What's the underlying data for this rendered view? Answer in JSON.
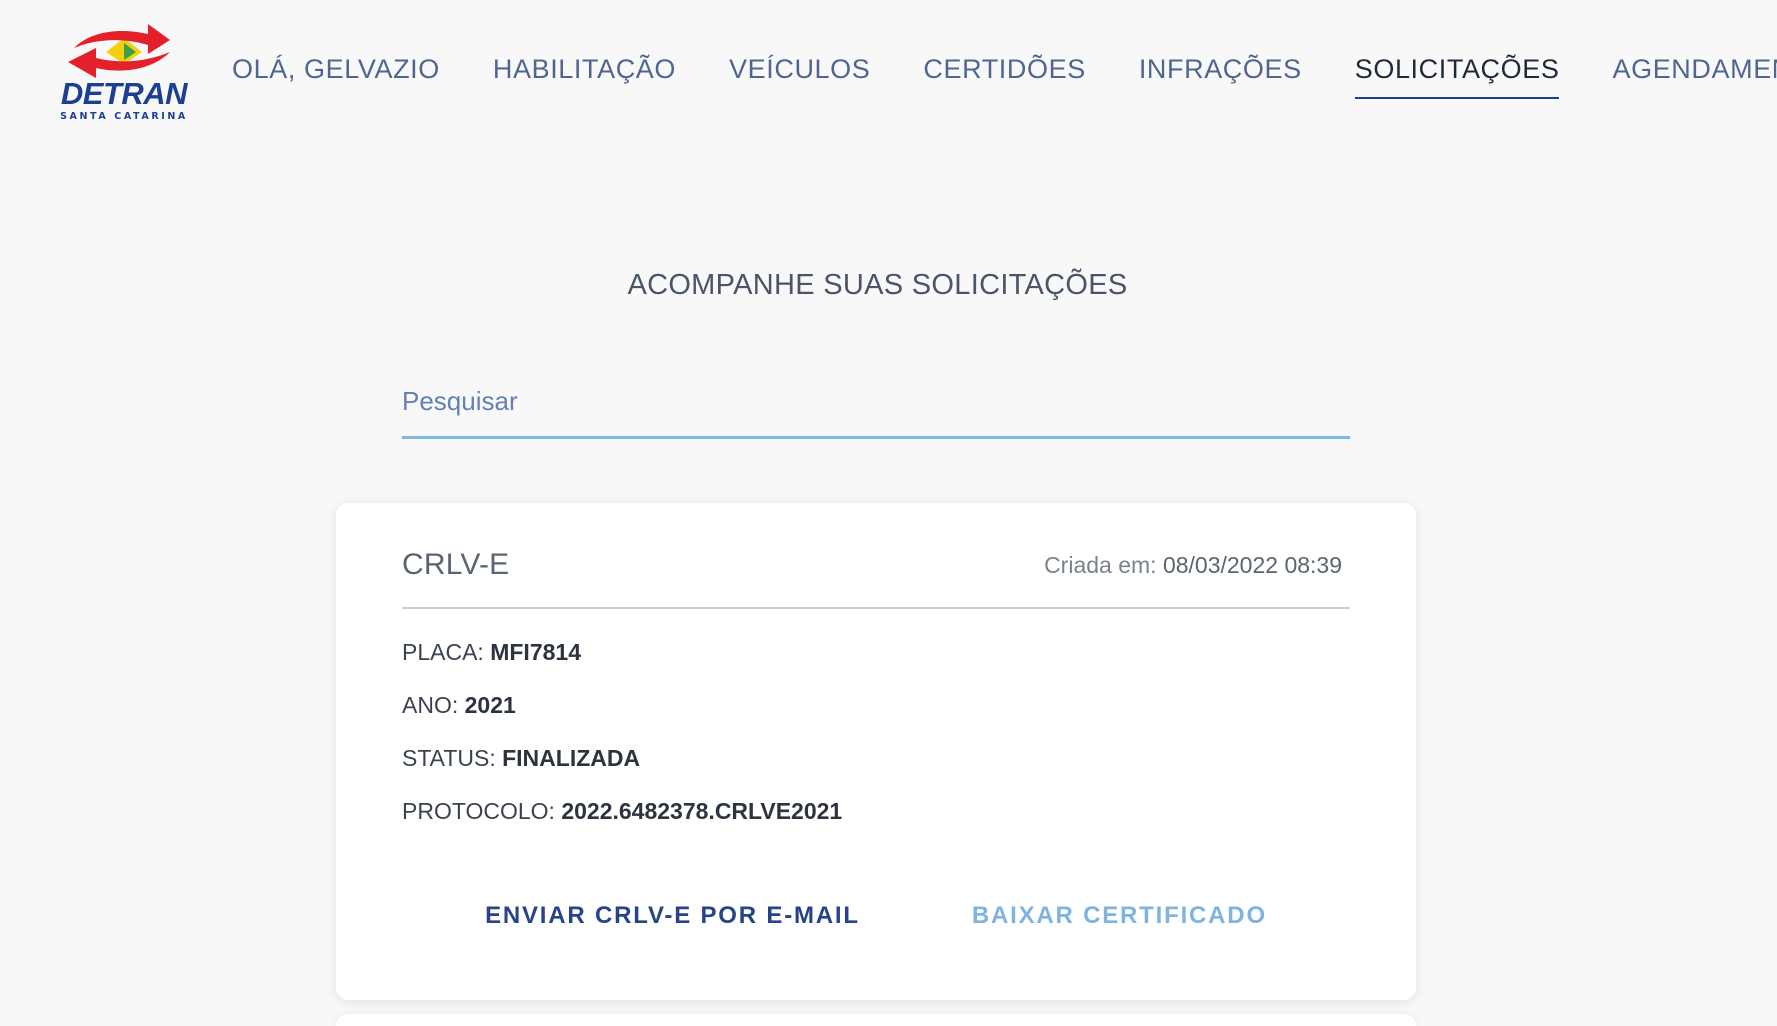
{
  "brand": {
    "name": "DETRAN",
    "subtitle": "SANTA CATARINA",
    "colors": {
      "blue": "#1d3f93",
      "red": "#e4202a",
      "yellow": "#f5d10b",
      "green": "#3aa04a"
    }
  },
  "nav": {
    "items": [
      {
        "label": "OLÁ, GELVAZIO"
      },
      {
        "label": "HABILITAÇÃO"
      },
      {
        "label": "VEÍCULOS"
      },
      {
        "label": "CERTIDÕES"
      },
      {
        "label": "INFRAÇÕES"
      },
      {
        "label": "SOLICITAÇÕES"
      },
      {
        "label": "AGENDAMENTO"
      }
    ],
    "active": "SOLICITAÇÕES"
  },
  "page": {
    "title": "ACOMPANHE SUAS SOLICITAÇÕES"
  },
  "search": {
    "placeholder": "Pesquisar",
    "value": ""
  },
  "request": {
    "title": "CRLV-E",
    "created_label": "Criada em:",
    "created_value": "08/03/2022 08:39",
    "fields": [
      {
        "label": "PLACA:",
        "value": "MFI7814"
      },
      {
        "label": "ANO:",
        "value": "2021"
      },
      {
        "label": "STATUS:",
        "value": "FINALIZADA"
      },
      {
        "label": "PROTOCOLO:",
        "value": "2022.6482378.CRLVE2021"
      }
    ],
    "actions": {
      "email_label": "ENVIAR CRLV-E POR E-MAIL",
      "certificate_label": "BAIXAR CERTIFICADO"
    }
  }
}
